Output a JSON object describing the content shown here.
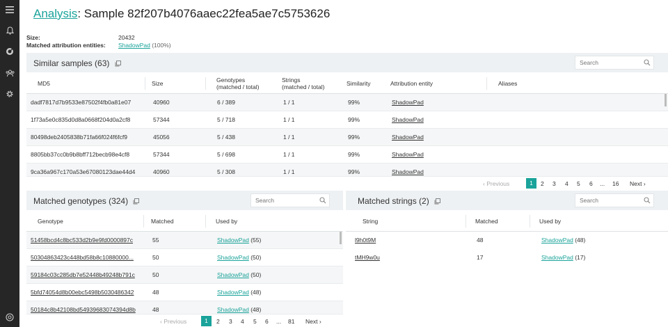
{
  "page": {
    "title_link": "Analysis",
    "title_rest": ": Sample 82f207b4076aaec22fea5ae7c5753626",
    "size_label": "Size:",
    "size_value": "20432",
    "matched_label": "Matched attribution entities:",
    "matched_entity": "ShadowPad",
    "matched_pct": "(100%)"
  },
  "colors": {
    "accent": "#1aa39a",
    "nav_bg": "#262626",
    "header_bg": "#eef1f3"
  },
  "nav": {
    "icons": [
      "menu-icon",
      "bell-icon",
      "target-icon",
      "users-icon",
      "gear-icon",
      "help-icon"
    ]
  },
  "similar": {
    "title": "Similar samples (63)",
    "search_placeholder": "Search",
    "columns": {
      "md5": "MD5",
      "size": "Size",
      "genotypes": [
        "Genotypes",
        "(matched / total)"
      ],
      "strings": [
        "Strings",
        "(matched / total)"
      ],
      "similarity": "Similarity",
      "entity": "Attribution entity",
      "aliases": "Aliases"
    },
    "rows": [
      {
        "md5": "dadf7817d7b9533e87502f4fb0a81e07",
        "size": "40960",
        "genotypes": "6 / 389",
        "strings": "1 / 1",
        "similarity": "99%",
        "entity": "ShadowPad"
      },
      {
        "md5": "1f73a5e0c835d0d8a0668f204d0a2cf8",
        "size": "57344",
        "genotypes": "5 / 718",
        "strings": "1 / 1",
        "similarity": "99%",
        "entity": "ShadowPad"
      },
      {
        "md5": "80498deb2405838b71fa66f024f6fcf9",
        "size": "45056",
        "genotypes": "5 / 438",
        "strings": "1 / 1",
        "similarity": "99%",
        "entity": "ShadowPad"
      },
      {
        "md5": "8805bb37cc0b9b8bff712becb98e4cf8",
        "size": "57344",
        "genotypes": "5 / 698",
        "strings": "1 / 1",
        "similarity": "99%",
        "entity": "ShadowPad"
      },
      {
        "md5": "9ca36a967c170a53e67080123dae44d4",
        "size": "40960",
        "genotypes": "5 / 308",
        "strings": "1 / 1",
        "similarity": "99%",
        "entity": "ShadowPad"
      }
    ],
    "pager": {
      "prev": "Previous",
      "pages": [
        "1",
        "2",
        "3",
        "4",
        "5",
        "6"
      ],
      "ellipsis": "...",
      "last": "16",
      "next": "Next"
    }
  },
  "genotypes": {
    "title": "Matched genotypes (324)",
    "search_placeholder": "Search",
    "columns": {
      "genotype": "Genotype",
      "matched": "Matched",
      "used_by": "Used by"
    },
    "rows": [
      {
        "genotype": "51458bcd4c8bc533d2b9e9fd0000897c",
        "matched": "55",
        "entity": "ShadowPad",
        "count": "(55)"
      },
      {
        "genotype": "50304863423c448bd58b8c10880000...",
        "matched": "50",
        "entity": "ShadowPad",
        "count": "(50)"
      },
      {
        "genotype": "59184c03c285db7e52448b49248b791c",
        "matched": "50",
        "entity": "ShadowPad",
        "count": "(50)"
      },
      {
        "genotype": "5bfd74054d8b00ebc5498b5030486342",
        "matched": "48",
        "entity": "ShadowPad",
        "count": "(48)"
      },
      {
        "genotype": "50184c8b42108bd54939683074394d8b",
        "matched": "48",
        "entity": "ShadowPad",
        "count": "(48)"
      }
    ],
    "pager": {
      "prev": "Previous",
      "pages": [
        "1",
        "2",
        "3",
        "4",
        "5",
        "6"
      ],
      "ellipsis": "...",
      "last": "81",
      "next": "Next"
    }
  },
  "strings": {
    "title": "Matched strings (2)",
    "search_placeholder": "Search",
    "columns": {
      "string": "String",
      "matched": "Matched",
      "used_by": "Used by"
    },
    "rows": [
      {
        "string": "l9h0t9M",
        "matched": "48",
        "entity": "ShadowPad",
        "count": "(48)"
      },
      {
        "string": "tMH9w0u",
        "matched": "17",
        "entity": "ShadowPad",
        "count": "(17)"
      }
    ]
  }
}
